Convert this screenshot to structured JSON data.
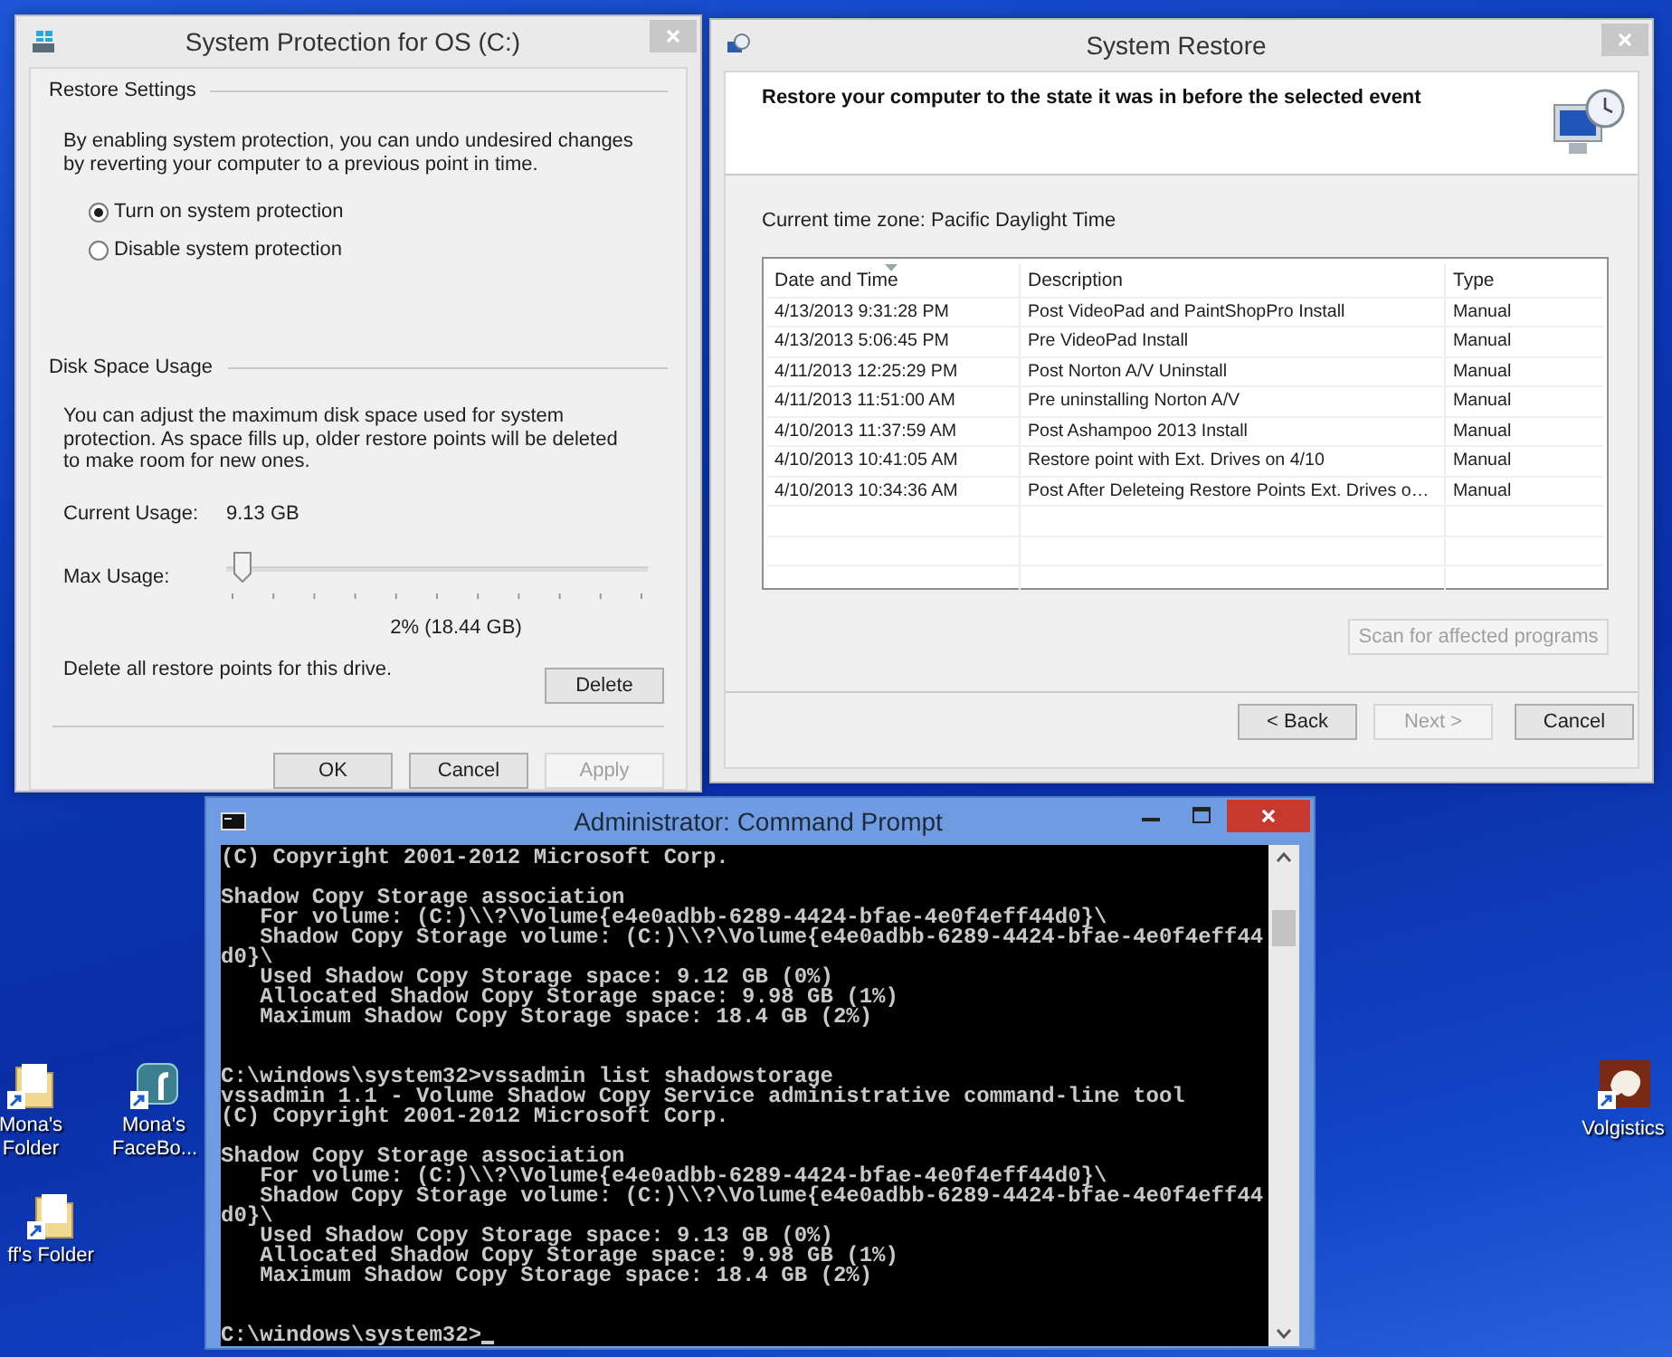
{
  "system_protection": {
    "title": "System Protection for OS (C:)",
    "restore_settings": {
      "heading": "Restore Settings",
      "description": "By enabling system protection, you can undo undesired changes by reverting your computer to a previous point in time.",
      "options": [
        {
          "label": "Turn on system protection",
          "selected": true
        },
        {
          "label": "Disable system protection",
          "selected": false
        }
      ]
    },
    "disk_space": {
      "heading": "Disk Space Usage",
      "description": "You can adjust the maximum disk space used for system protection. As space fills up, older restore points will be deleted to make room for new ones.",
      "current_usage_label": "Current Usage:",
      "current_usage": "9.13 GB",
      "max_usage_label": "Max Usage:",
      "max_usage": {
        "level": 0.02
      },
      "max_usage_reading": "2% (18.44 GB)",
      "delete_text": "Delete all restore points for this drive.",
      "delete_button": "Delete"
    },
    "buttons": [
      {
        "label": "OK",
        "disabled": false
      },
      {
        "label": "Cancel",
        "disabled": false
      },
      {
        "label": "Apply",
        "disabled": true
      }
    ]
  },
  "system_restore": {
    "title": "System Restore",
    "heading": "Restore your computer to the state it was in before the selected event",
    "time_zone": "Current time zone: Pacific Daylight Time",
    "table": {
      "columns": [
        {
          "label": "Date and Time",
          "sorted": true
        },
        {
          "label": "Description",
          "sorted": false
        },
        {
          "label": "Type",
          "sorted": false
        }
      ],
      "rows": [
        [
          "4/13/2013 9:31:28 PM",
          "Post VideoPad and PaintShopPro Install",
          "Manual"
        ],
        [
          "4/13/2013 5:06:45 PM",
          "Pre VideoPad Install",
          "Manual"
        ],
        [
          "4/11/2013 12:25:29 PM",
          "Post Norton A/V Uninstall",
          "Manual"
        ],
        [
          "4/11/2013 11:51:00 AM",
          "Pre uninstalling Norton A/V",
          "Manual"
        ],
        [
          "4/10/2013 11:37:59 AM",
          "Post Ashampoo 2013 Install",
          "Manual"
        ],
        [
          "4/10/2013 10:41:05 AM",
          "Restore point with Ext. Drives on 4/10",
          "Manual"
        ],
        [
          "4/10/2013 10:34:36 AM",
          "Post After Deleteing Restore Points Ext. Drives o…",
          "Manual"
        ]
      ]
    },
    "scan_button": {
      "label": "Scan for affected programs",
      "disabled": true
    },
    "buttons": [
      {
        "label": "< Back",
        "disabled": false
      },
      {
        "label": "Next >",
        "disabled": true
      },
      {
        "label": "Cancel",
        "disabled": false
      }
    ]
  },
  "command_prompt": {
    "title": "Administrator: Command Prompt",
    "blocks": [
      {
        "kind": "output",
        "lines": [
          "(C) Copyright 2001-2012 Microsoft Corp."
        ]
      },
      {
        "kind": "output",
        "lines": [
          "Shadow Copy Storage association",
          "   For volume: (C:)\\\\?\\Volume{e4e0adbb-6289-4424-bfae-4e0f4eff44d0}\\",
          "   Shadow Copy Storage volume: (C:)\\\\?\\Volume{e4e0adbb-6289-4424-bfae-4e0f4eff44",
          "d0}\\",
          "   Used Shadow Copy Storage space: 9.12 GB (0%)",
          "   Allocated Shadow Copy Storage space: 9.98 GB (1%)",
          "   Maximum Shadow Copy Storage space: 18.4 GB (2%)"
        ]
      },
      {
        "kind": "command",
        "lines": [
          "C:\\windows\\system32>vssadmin list shadowstorage",
          "vssadmin 1.1 - Volume Shadow Copy Service administrative command-line tool",
          "(C) Copyright 2001-2012 Microsoft Corp."
        ]
      },
      {
        "kind": "output",
        "lines": [
          "Shadow Copy Storage association",
          "   For volume: (C:)\\\\?\\Volume{e4e0adbb-6289-4424-bfae-4e0f4eff44d0}\\",
          "   Shadow Copy Storage volume: (C:)\\\\?\\Volume{e4e0adbb-6289-4424-bfae-4e0f4eff44",
          "d0}\\",
          "   Used Shadow Copy Storage space: 9.13 GB (0%)",
          "   Allocated Shadow Copy Storage space: 9.98 GB (1%)",
          "   Maximum Shadow Copy Storage space: 18.4 GB (2%)"
        ]
      },
      {
        "kind": "prompt",
        "lines": [
          "C:\\windows\\system32>"
        ]
      }
    ]
  },
  "desktop_icons": [
    {
      "kind": "folder",
      "label": "Mona's Folder"
    },
    {
      "kind": "folder",
      "label": "ff's Folder"
    },
    {
      "kind": "tile",
      "label": "Mona's FaceBo..."
    },
    {
      "kind": "animal",
      "label": "Volgistics"
    }
  ]
}
